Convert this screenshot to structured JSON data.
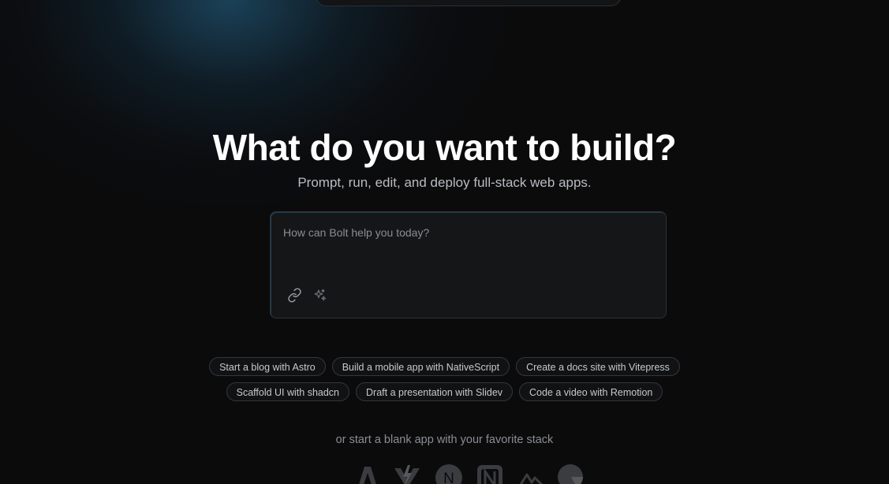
{
  "hero": {
    "title": "What do you want to build?",
    "subtitle": "Prompt, run, edit, and deploy full-stack web apps."
  },
  "prompt": {
    "placeholder": "How can Bolt help you today?",
    "attach_icon": "link-icon",
    "enhance_icon": "sparkles-icon"
  },
  "suggestions": {
    "row1": [
      "Start a blog with Astro",
      "Build a mobile app with NativeScript",
      "Create a docs site with Vitepress"
    ],
    "row2": [
      "Scaffold UI with shadcn",
      "Draft a presentation with Slidev",
      "Code a video with Remotion"
    ]
  },
  "blank_app": {
    "text": "or start a blank app with your favorite stack",
    "stacks": [
      "astro-icon",
      "vite-icon",
      "nextjs-icon",
      "nativescript-icon",
      "nuxt-icon",
      "remix-icon"
    ]
  },
  "colors": {
    "background": "#0b0b0c",
    "accent_glow": "#286e96",
    "text_primary": "#ffffff",
    "text_secondary": "#b9bcc2",
    "text_muted": "#8a8d92"
  }
}
